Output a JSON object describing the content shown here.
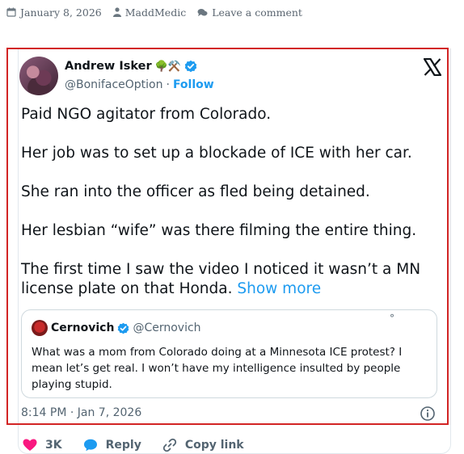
{
  "post_meta": {
    "date": "January 8, 2026",
    "author": "MaddMedic",
    "comment_link": "Leave a comment",
    "date_icon": "calendar-icon",
    "author_icon": "user-icon",
    "comment_icon": "comment-icon"
  },
  "tweet": {
    "author_name": "Andrew Isker",
    "author_emojis": "🌳⚒️",
    "handle": "@BonifaceOption",
    "separator": "·",
    "follow_label": "Follow",
    "paragraphs": [
      "Paid NGO agitator from Colorado.",
      "Her job was to set up a blockade of ICE with her car.",
      "She ran into the officer as fled being detained.",
      "Her lesbian “wife” was there filming the entire thing.",
      "The first time I saw the video I noticed it wasn’t a MN license plate on that Honda."
    ],
    "show_more": "Show more",
    "quote": {
      "name": "Cernovich",
      "handle": "@Cernovich",
      "text": "What was a mom from Colorado doing at a Minnesota ICE protest? I mean let’s get real. I won’t have my intelligence insulted by people playing stupid.",
      "dot": "°"
    },
    "timestamp": "8:14 PM · Jan 7, 2026",
    "actions": {
      "likes": "3K",
      "reply": "Reply",
      "copy_link": "Copy link"
    },
    "colors": {
      "accent": "#1d9bf0",
      "like": "#f91880",
      "highlight_border": "#d22424"
    }
  }
}
